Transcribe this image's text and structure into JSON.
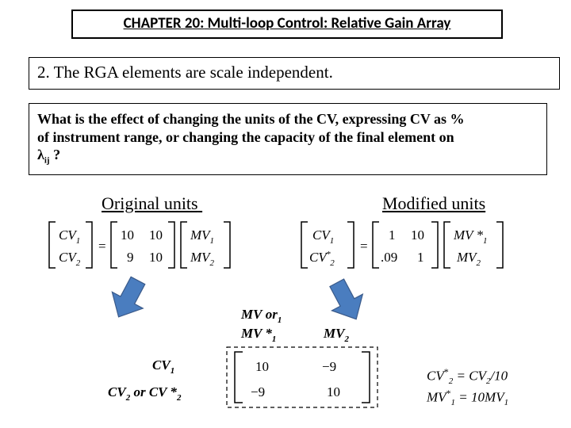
{
  "title": {
    "chapter": "CHAPTER 20:",
    "rest": " Multi-loop Control: Relative Gain Array"
  },
  "property": {
    "number": "2.",
    "text": "The RGA elements are scale independent."
  },
  "question": {
    "line1": "What is the effect of changing the units of the CV, expressing CV as %",
    "line2": "of instrument range, or changing the capacity of the final element on",
    "lambda": "λ",
    "lambda_sub": "ij",
    "qmark": " ?"
  },
  "headings": {
    "original": "Original units",
    "modified": "Modified units"
  },
  "equations": {
    "left": {
      "cv_rows": [
        "CV",
        "CV"
      ],
      "cv_subs": [
        "1",
        "2"
      ],
      "gain": [
        [
          "10",
          "10"
        ],
        [
          "9",
          "10"
        ]
      ],
      "mv_rows": [
        "MV",
        "MV"
      ],
      "mv_subs": [
        "1",
        "2"
      ]
    },
    "right": {
      "cv_rows": [
        "CV",
        "CV"
      ],
      "cv_star": [
        false,
        true
      ],
      "cv_subs": [
        "1",
        "2"
      ],
      "gain": [
        [
          "1",
          "10"
        ],
        [
          ".09",
          "1"
        ]
      ],
      "mv_rows": [
        "MV *",
        "MV"
      ],
      "mv_subs": [
        "1",
        "2"
      ]
    },
    "rga_header": {
      "col1_a": "MV",
      "col1_b": "or",
      "col1_sub": "1",
      "col2_a": "MV *",
      "col2_sub": "1",
      "col3": "MV",
      "col3_sub": "2"
    },
    "rga_rows": {
      "r1": "CV",
      "r1_sub": "1",
      "r2_a": "CV",
      "r2_sub_a": "2",
      "r2_or": "or",
      "r2_b": "CV *",
      "r2_sub_b": "2"
    },
    "rga_matrix": [
      [
        "10",
        "−9"
      ],
      [
        "−9",
        "10"
      ]
    ]
  },
  "note": {
    "line1_lhs_sym": "CV",
    "line1_lhs_sub": "2",
    "line1_eq": " = ",
    "line1_rhs_sym": "CV",
    "line1_rhs_sub": "2",
    "line1_div": "/10",
    "line2_lhs_sym": "MV",
    "line2_lhs_sub": "1",
    "line2_eq": " = 10",
    "line2_rhs_sym": "MV",
    "line2_rhs_sub": "1"
  }
}
